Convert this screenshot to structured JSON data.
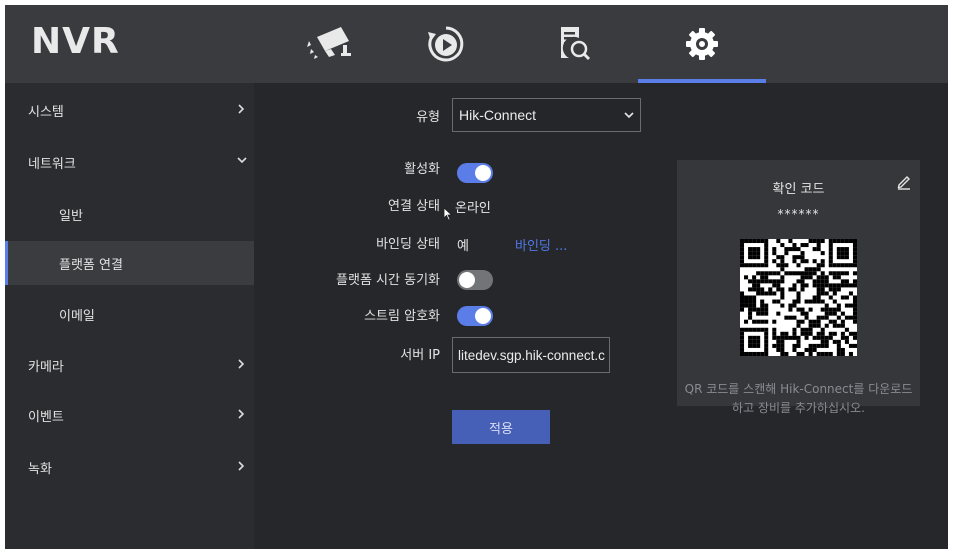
{
  "app": {
    "logo": "NVR"
  },
  "top_nav": {
    "tabs": [
      {
        "name": "camera",
        "icon": "camera-icon"
      },
      {
        "name": "playback",
        "icon": "playback-icon"
      },
      {
        "name": "search",
        "icon": "file-search-icon"
      },
      {
        "name": "settings",
        "icon": "gear-icon",
        "active": true
      }
    ]
  },
  "sidebar": {
    "items": [
      {
        "label": "시스템",
        "chevron": "right"
      },
      {
        "label": "네트워크",
        "chevron": "down"
      },
      {
        "label": "일반",
        "sub": true
      },
      {
        "label": "플랫폼 연결",
        "sub": true,
        "active": true
      },
      {
        "label": "이메일",
        "sub": true
      },
      {
        "label": "카메라",
        "chevron": "right"
      },
      {
        "label": "이벤트",
        "chevron": "right"
      },
      {
        "label": "녹화",
        "chevron": "right"
      }
    ]
  },
  "form": {
    "type": {
      "label": "유형",
      "value": "Hik-Connect"
    },
    "enable": {
      "label": "활성화",
      "on": true
    },
    "connection_status": {
      "label": "연결 상태",
      "value": "온라인"
    },
    "binding_status": {
      "label": "바인딩 상태",
      "value": "예",
      "link": "바인딩 ..."
    },
    "platform_time_sync": {
      "label": "플랫폼 시간 동기화",
      "on": false
    },
    "stream_encryption": {
      "label": "스트림 암호화",
      "on": true
    },
    "server_ip": {
      "label": "서버 IP",
      "value": "litedev.sgp.hik-connect.c"
    },
    "apply_label": "적용"
  },
  "qr_panel": {
    "title": "확인 코드",
    "code": "******",
    "description_line1": "QR 코드를 스캔해 Hik-Connect를 다운로드",
    "description_line2": "하고 장비를 추가하십시오."
  },
  "colors": {
    "accent": "#5b7de8",
    "link": "#4f78e6",
    "background": "#26272b"
  }
}
